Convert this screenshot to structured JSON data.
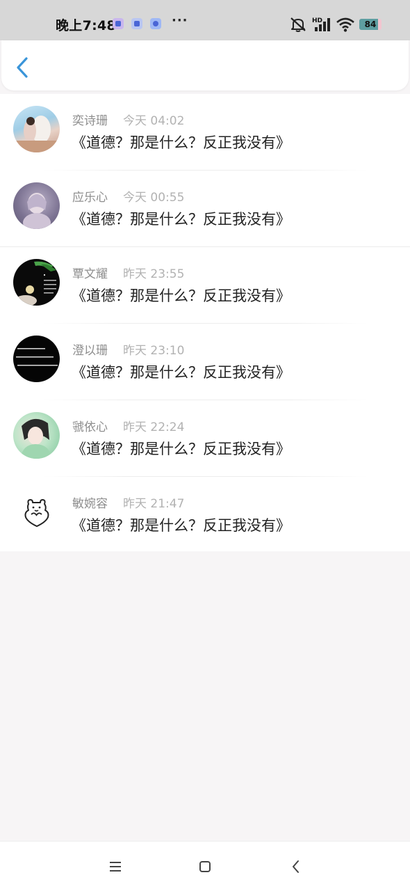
{
  "status_bar": {
    "time": "晚上7:48",
    "more": "···",
    "hd_label": "HD",
    "battery_level": 84,
    "battery_text": "84",
    "icons": [
      "app-icon-1",
      "app-icon-2",
      "app-icon-3",
      "mute-icon",
      "signal-icon",
      "wifi-icon",
      "battery-icon"
    ]
  },
  "header": {
    "back_icon": "chevron-left-icon",
    "accent_color": "#3a95d9"
  },
  "messages": [
    {
      "name": "奕诗珊",
      "time": "今天 04:02",
      "text": "《道德？那是什么？反正我没有》"
    },
    {
      "name": "应乐心",
      "time": "今天 00:55",
      "text": "《道德？那是什么？反正我没有》"
    },
    {
      "name": "覃文耀",
      "time": "昨天 23:55",
      "text": "《道德？那是什么？反正我没有》"
    },
    {
      "name": "澄以珊",
      "time": "昨天 23:10",
      "text": "《道德？那是什么？反正我没有》"
    },
    {
      "name": "虢依心",
      "time": "昨天 22:24",
      "text": "《道德？那是什么？反正我没有》"
    },
    {
      "name": "敏婉容",
      "time": "昨天 21:47",
      "text": "《道德？那是什么？反正我没有》"
    }
  ],
  "nav_bar": {
    "icons": [
      "menu-icon",
      "home-icon",
      "back-icon"
    ]
  }
}
